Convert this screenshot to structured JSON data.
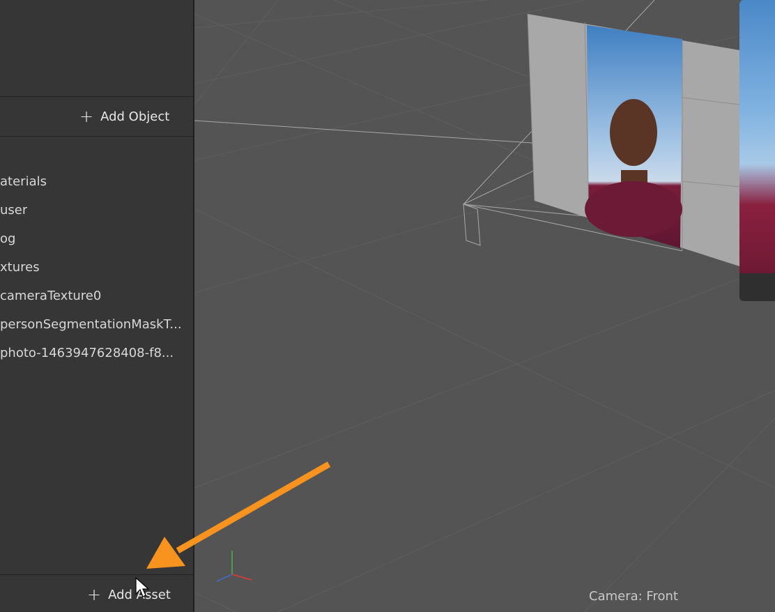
{
  "panel": {
    "add_object_label": "Add Object",
    "add_asset_label": "Add Asset",
    "assets": [
      "aterials",
      "user",
      "og",
      "xtures",
      "cameraTexture0",
      "personSegmentationMaskT...",
      "photo-1463947628408-f8..."
    ]
  },
  "viewport": {
    "camera_label": "Camera: Front"
  },
  "colors": {
    "panel_bg": "#363636",
    "viewport_bg": "#545454",
    "arrow": "#f7931e",
    "plane_gray": "#a8a8a8"
  },
  "icons": {
    "plus": "plus-icon",
    "cursor": "mouse-pointer-icon",
    "arrow": "annotation-arrow-icon",
    "gizmo": "axis-gizmo-icon"
  }
}
